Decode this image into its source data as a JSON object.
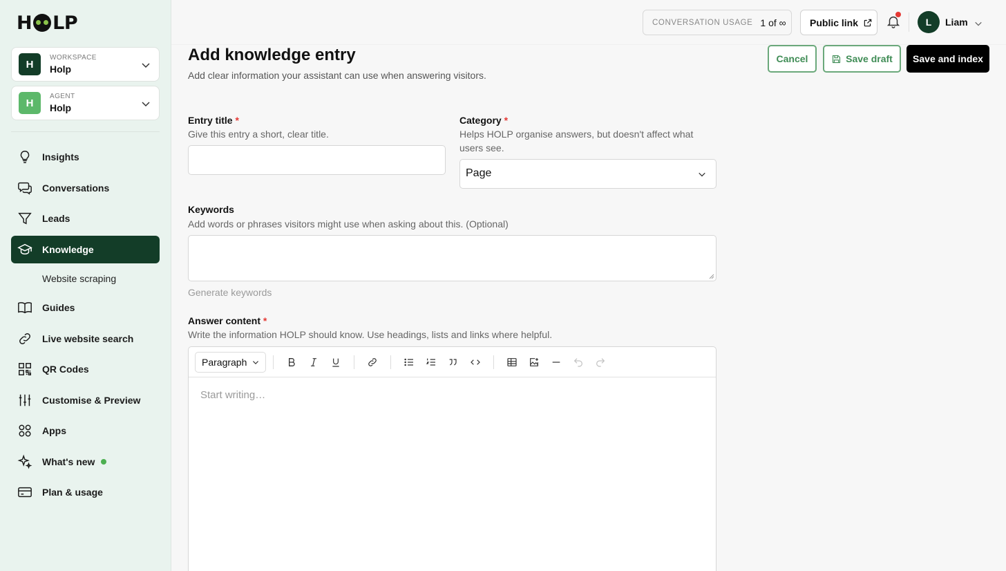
{
  "brand": {
    "name_start": "H",
    "name_end": "LP"
  },
  "sidebar": {
    "workspace": {
      "label": "WORKSPACE",
      "value": "Holp",
      "initial": "H",
      "color": "#133d28"
    },
    "agent": {
      "label": "AGENT",
      "value": "Holp",
      "initial": "H",
      "color": "#5cb86a"
    },
    "nav": [
      {
        "label": "Insights",
        "icon": "lightbulb-icon"
      },
      {
        "label": "Conversations",
        "icon": "chat-bubbles-icon"
      },
      {
        "label": "Leads",
        "icon": "funnel-icon"
      },
      {
        "label": "Knowledge",
        "icon": "graduation-cap-icon",
        "active": true
      },
      {
        "label": "Guides",
        "icon": "book-icon"
      },
      {
        "label": "Live website search",
        "icon": "link-icon"
      },
      {
        "label": "QR Codes",
        "icon": "qr-code-icon"
      },
      {
        "label": "Customise & Preview",
        "icon": "sliders-icon"
      },
      {
        "label": "Apps",
        "icon": "apps-grid-icon"
      },
      {
        "label": "What's new",
        "icon": "sparkles-icon",
        "badge": "new-dot"
      },
      {
        "label": "Plan & usage",
        "icon": "credit-card-icon"
      }
    ],
    "sub_item": "Website scraping"
  },
  "topbar": {
    "usage_label": "CONVERSATION USAGE",
    "usage_value": "1 of ∞",
    "public_link": "Public link",
    "user_initial": "L",
    "user_name": "Liam"
  },
  "header": {
    "title": "Add knowledge entry",
    "subtitle": "Add clear information your assistant can use when answering visitors.",
    "cancel": "Cancel",
    "save_draft": "Save draft",
    "save_index": "Save and index"
  },
  "form": {
    "entry_title": {
      "label": "Entry title",
      "help": "Give this entry a short, clear title.",
      "value": ""
    },
    "category": {
      "label": "Category",
      "help": "Helps HOLP organise answers, but doesn't affect what users see.",
      "value": "Page"
    },
    "keywords": {
      "label": "Keywords",
      "help": "Add words or phrases visitors might use when asking about this. (Optional)",
      "value": "",
      "generate": "Generate keywords"
    },
    "answer": {
      "label": "Answer content",
      "help": "Write the information HOLP should know. Use headings, lists and links where helpful.",
      "placeholder": "Start writing…",
      "block_type": "Paragraph"
    },
    "required_mark": "*"
  },
  "colors": {
    "brand_dark": "#133d28",
    "accent_green": "#3f8c55",
    "notification": "#e53935"
  }
}
